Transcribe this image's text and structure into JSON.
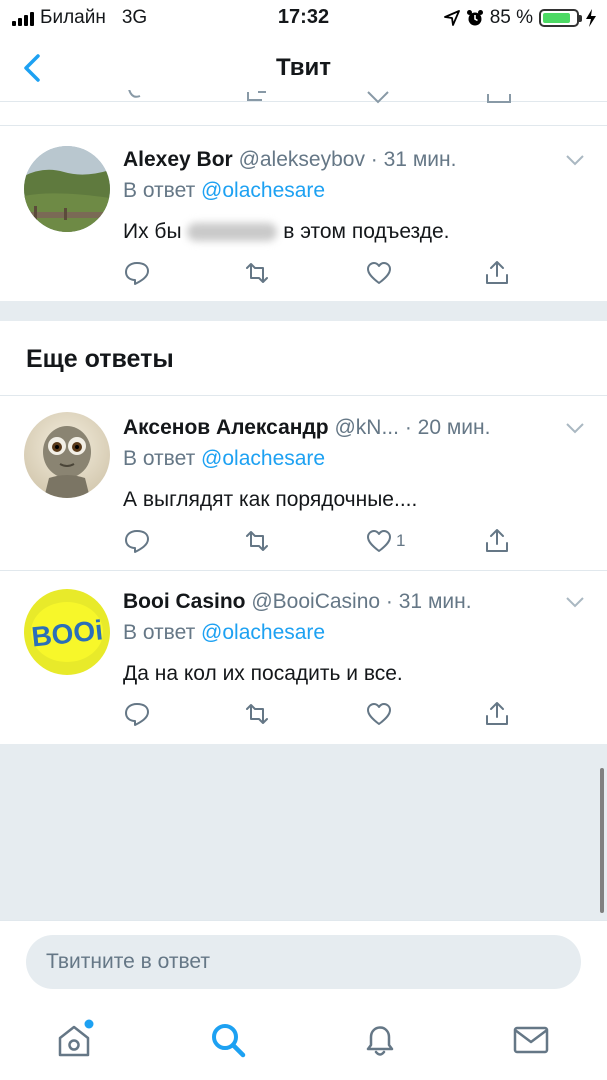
{
  "status_bar": {
    "carrier": "Билайн",
    "network": "3G",
    "time": "17:32",
    "battery_percent_label": "85 %",
    "battery_level": 0.85
  },
  "nav": {
    "title": "Твит",
    "back_icon": "chevron-left-icon"
  },
  "tweets": [
    {
      "name": "Alexey Bor",
      "handle": "@alekseybov",
      "time": "· 31 мин.",
      "reply_prefix": "В ответ",
      "reply_to": "@olachesare",
      "text_before": "Их бы",
      "text_after": "в этом подъезде.",
      "like_count": ""
    },
    {
      "name": "Аксенов Александр",
      "handle": "@kN...",
      "time": "· 20 мин.",
      "reply_prefix": "В ответ",
      "reply_to": "@olachesare",
      "text": "А выглядят как порядочные....",
      "like_count": "1"
    },
    {
      "name": "Booi Casino",
      "handle": "@BooiCasino",
      "time": "· 31 мин.",
      "reply_prefix": "В ответ",
      "reply_to": "@olachesare",
      "text": "Да на кол их посадить и все.",
      "like_count": "",
      "avatar_text": "BOOi"
    }
  ],
  "more_replies_title": "Еще ответы",
  "reply_bar": {
    "placeholder": "Твитните в ответ"
  },
  "tab_bar": {
    "items": [
      "home-icon",
      "search-icon",
      "notifications-bell-icon",
      "messages-envelope-icon"
    ],
    "active": "search-icon",
    "home_has_badge": true
  },
  "colors": {
    "accent": "#1da1f2",
    "text_primary": "#14171a",
    "text_secondary": "#657786",
    "separator_bg": "#e6ecf0",
    "battery": "#4cd964"
  }
}
